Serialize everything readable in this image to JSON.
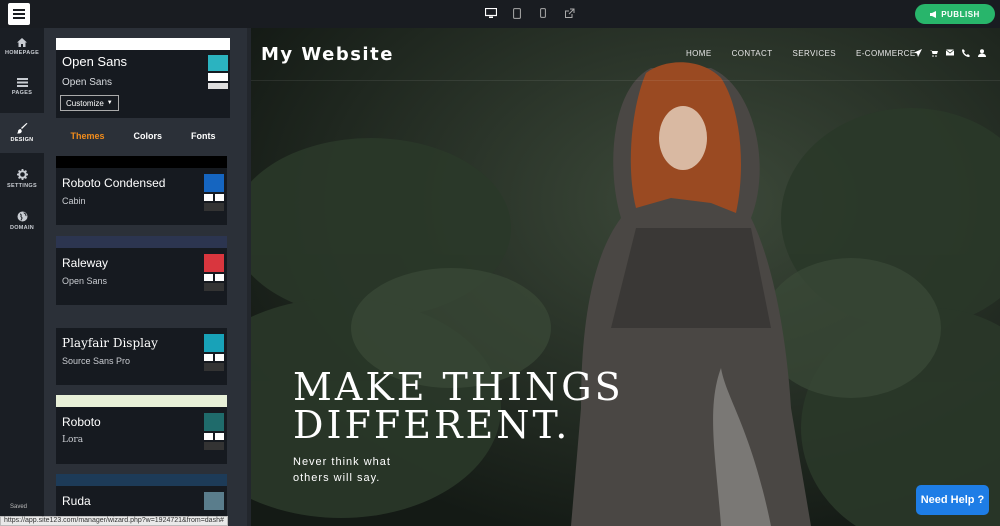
{
  "topbar": {
    "publish_label": "PUBLISH",
    "devices": [
      "desktop-icon",
      "tablet-icon",
      "mobile-icon",
      "external-link-icon"
    ]
  },
  "leftnav": {
    "items": [
      {
        "label": "HOMEPAGE",
        "icon": "home-icon"
      },
      {
        "label": "PAGES",
        "icon": "pages-icon"
      },
      {
        "label": "DESIGN",
        "icon": "brush-icon",
        "active": true
      },
      {
        "label": "SETTINGS",
        "icon": "gear-icon"
      },
      {
        "label": "DOMAIN",
        "icon": "globe-icon"
      }
    ],
    "saved_label": "Saved"
  },
  "panel": {
    "current": {
      "heading_font": "Open Sans",
      "body_font": "Open Sans",
      "customize_label": "Customize",
      "colors": [
        "#2bb3c0",
        "#ffffff",
        "#dddddd"
      ]
    },
    "tabs": [
      {
        "label": "Themes",
        "active": true
      },
      {
        "label": "Colors"
      },
      {
        "label": "Fonts"
      }
    ],
    "themes": [
      {
        "heading_font": "Roboto Condensed",
        "body_font": "Cabin",
        "accent": "#1565c0",
        "strip": "#000000"
      },
      {
        "heading_font": "Raleway",
        "body_font": "Open Sans",
        "accent": "#d9363e",
        "strip": "#2c3550"
      },
      {
        "heading_font": "Playfair Display",
        "body_font": "Source Sans Pro",
        "accent": "#18a2b8",
        "strip": "#2b3038"
      },
      {
        "heading_font": "Roboto",
        "body_font": "Lora",
        "accent": "#1f6b6b",
        "strip": "#e8f0d8"
      },
      {
        "heading_font": "Ruda",
        "body_font": "",
        "accent": "#5a7d8c",
        "strip": "#1d3b58"
      }
    ]
  },
  "preview": {
    "site_title": "My Website",
    "nav": [
      "HOME",
      "CONTACT",
      "SERVICES",
      "E-COMMERCE"
    ],
    "nav_icons": [
      "send-icon",
      "cart-icon",
      "mail-icon",
      "phone-icon",
      "user-icon"
    ],
    "headline_line1": "MAKE THINGS",
    "headline_line2": "DIFFERENT.",
    "subline1": "Never think what",
    "subline2": "others will say."
  },
  "help_label": "Need Help ?",
  "status_url": "https://app.site123.com/manager/wizard.php?w=1924721&from=dash#"
}
